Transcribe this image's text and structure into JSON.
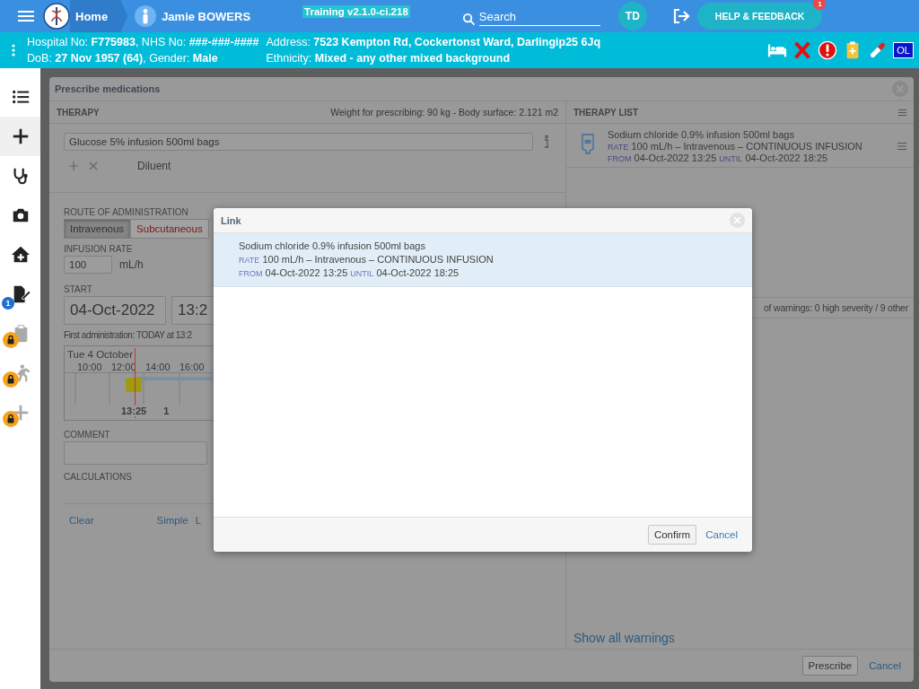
{
  "header": {
    "home": "Home",
    "patient_name": "Jamie BOWERS",
    "build": "Training v2.1.0-ci.218",
    "search_placeholder": "Search",
    "user_initials": "TD",
    "help_button": "HELP & FEEDBACK",
    "help_badge": "1"
  },
  "patient_banner": {
    "line_1": "Hospital No: **F775983**, NHS No: **###-###-####**",
    "line_2": "DoB: **27 Nov 1957 (64)**, Gender: **Male**",
    "line_3": "Address: **7523 Kempton Rd, Cockertonst Ward, Darlingip25 6Jq**",
    "line_4": "Ethnicity: **Mixed - any other mixed background**",
    "status_badge": "OL"
  },
  "sidebar": {
    "items": [
      {
        "selected": false,
        "locked": false
      },
      {
        "selected": true,
        "locked": false
      },
      {
        "selected": false,
        "locked": false
      },
      {
        "selected": false,
        "locked": false
      },
      {
        "selected": false,
        "locked": false
      },
      {
        "selected": false,
        "locked": false,
        "badge": "1"
      },
      {
        "selected": false,
        "locked": true
      },
      {
        "selected": false,
        "locked": true
      },
      {
        "selected": false,
        "locked": true
      }
    ]
  },
  "prescribe_dialog": {
    "title": "Prescribe medications",
    "therapy": {
      "heading": "THERAPY",
      "weight_info": "Weight for prescribing: 90 kg - Body surface: 2.121 m2",
      "medication": "Glucose 5% infusion 500ml bags",
      "diluent_label": "Diluent",
      "route_label": "ROUTE OF ADMINISTRATION",
      "routes": [
        {
          "label": "Intravenous",
          "selected": true,
          "alert": false
        },
        {
          "label": "Subcutaneous",
          "selected": false,
          "alert": true
        }
      ],
      "rate_label": "INFUSION RATE",
      "rate": "100",
      "rate_unit": "mL/h",
      "start_label": "START",
      "start_date": "04-Oct-2022",
      "start_time": "13:2",
      "first_administration": "First administration: TODAY at 13:2",
      "timeline": {
        "day": "Tue 4 October",
        "hours": [
          "10:00",
          "12:00",
          "14:00",
          "16:00"
        ],
        "dose_time": "13:25",
        "next_label": "1"
      },
      "comment_label": "COMMENT",
      "calculations_label": "CALCULATIONS",
      "links": [
        "Clear",
        "Simple",
        "L"
      ]
    },
    "therapy_list": {
      "heading": "THERAPY LIST",
      "items": [
        {
          "name": "Sodium chloride 0.9% infusion 500ml bags",
          "rate_label": "RATE",
          "rate": "100 mL/h – Intravenous – CONTINUOUS INFUSION",
          "from_label": "FROM",
          "from": "04-Oct-2022 13:25",
          "until_label": "UNTIL",
          "until": "04-Oct-2022 18:25"
        }
      ],
      "warnings_summary": "of warnings: 0 high severity / 9 other",
      "show_warnings": "Show all warnings"
    },
    "buttons": [
      "Prescribe",
      "Cancel"
    ]
  },
  "link_dialog": {
    "title": "Link",
    "items": [
      {
        "selected": true,
        "name": "Sodium chloride 0.9% infusion 500ml bags",
        "rate_label": "RATE",
        "rate": "100 mL/h – Intravenous – CONTINUOUS INFUSION",
        "from_label": "FROM",
        "from": "04-Oct-2022 13:25",
        "until_label": "UNTIL",
        "until": "04-Oct-2022 18:25"
      }
    ],
    "buttons": [
      "Confirm",
      "Cancel"
    ]
  }
}
